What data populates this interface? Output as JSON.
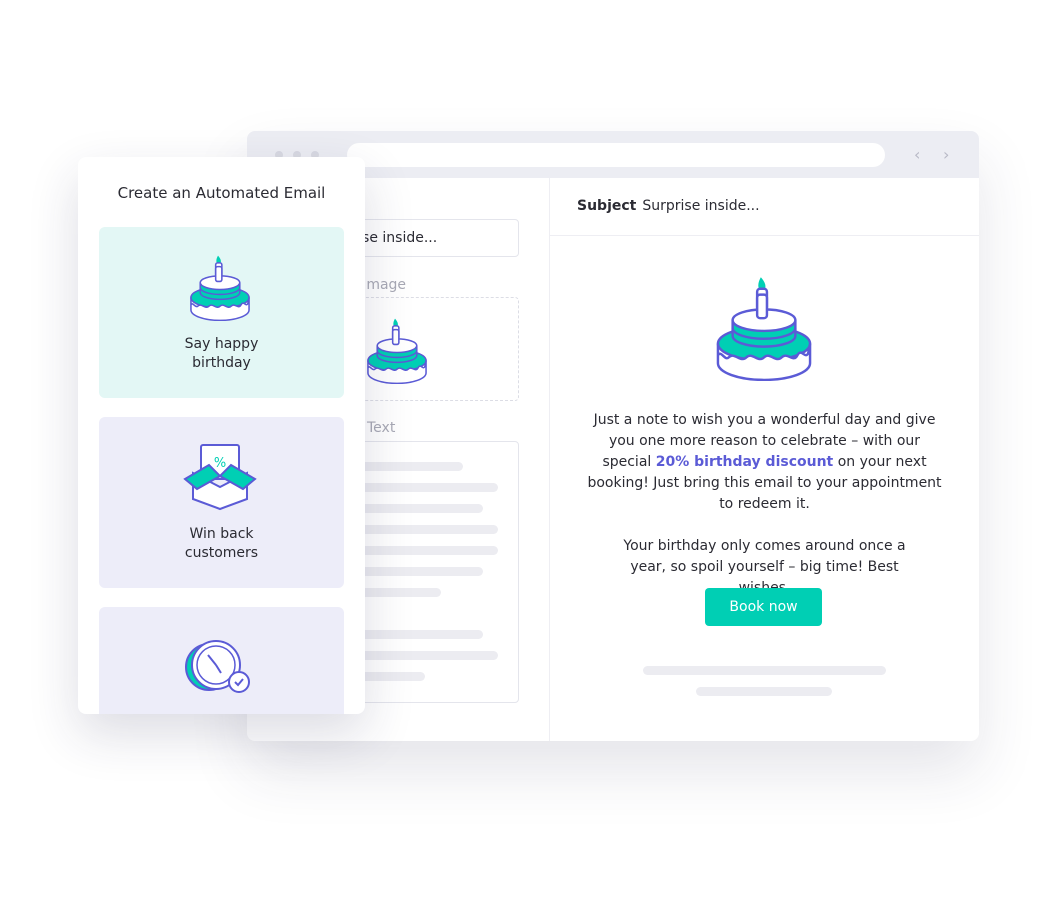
{
  "popup": {
    "title": "Create an Automated Email",
    "cards": [
      {
        "label_line1": "Say happy",
        "label_line2": "birthday",
        "icon": "birthday-cake-icon",
        "bg": "#e3f7f5"
      },
      {
        "label_line1": "Win back",
        "label_line2": "customers",
        "icon": "discount-box-icon",
        "bg": "#ededf9",
        "badge": "%"
      },
      {
        "icon": "clock-check-icon",
        "bg": "#ededf9"
      }
    ]
  },
  "editor": {
    "subject_value": "Surprise inside...",
    "header_image_label": "Header image",
    "text_label": "Text"
  },
  "preview": {
    "subject_label": "Subject",
    "subject_value": "Surprise inside...",
    "para1_a": "Just a note to wish you a wonderful day and give you one more reason to celebrate – with our special",
    "para1_highlight": "20% birthday discount",
    "para1_b": "on your next booking! Just bring this email to your appointment to redeem it.",
    "para2": "Your birthday only comes around once a year, so spoil yourself – big time! Best wishes.",
    "button": "Book now"
  },
  "colors": {
    "accent": "#00cfb4",
    "brand": "#5b5bd6"
  }
}
